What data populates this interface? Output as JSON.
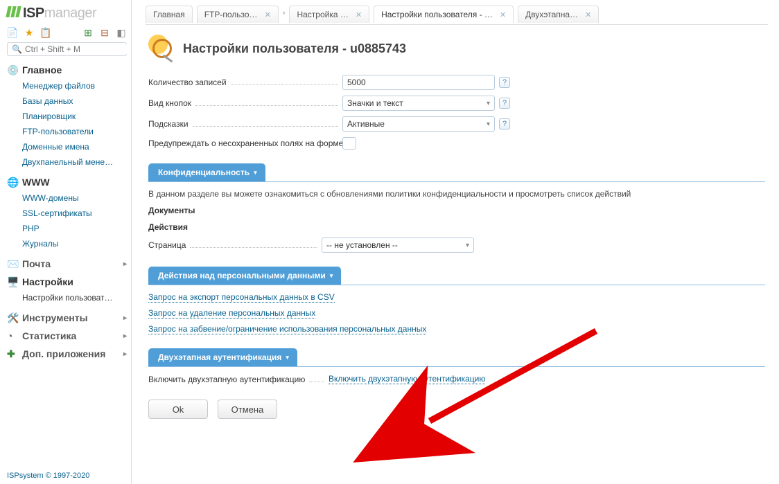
{
  "brand": {
    "isp": "ISP",
    "mgr": "manager"
  },
  "search_placeholder": "Ctrl + Shift + M",
  "sidebar": {
    "sections": [
      {
        "title": "Главное",
        "expanded": true,
        "icon": "disc-green",
        "items": [
          "Менеджер файлов",
          "Базы данных",
          "Планировщик",
          "FTP-пользователи",
          "Доменные имена",
          "Двухпанельный мене…"
        ]
      },
      {
        "title": "WWW",
        "expanded": true,
        "icon": "globe",
        "items": [
          "WWW-домены",
          "SSL-сертификаты",
          "PHP",
          "Журналы"
        ]
      },
      {
        "title": "Почта",
        "expanded": false,
        "icon": "mail",
        "items": []
      },
      {
        "title": "Настройки",
        "expanded": true,
        "icon": "monitor",
        "items": [
          "Настройки пользоват…"
        ]
      },
      {
        "title": "Инструменты",
        "expanded": false,
        "icon": "tools",
        "items": []
      },
      {
        "title": "Статистика",
        "expanded": false,
        "icon": "pie",
        "items": []
      },
      {
        "title": "Доп. приложения",
        "expanded": false,
        "icon": "plus",
        "items": []
      }
    ]
  },
  "footer": "ISPsystem © 1997-2020",
  "tabs": [
    {
      "label": "Главная",
      "closable": false,
      "active": false
    },
    {
      "label": "FTP-пользо…",
      "closable": true,
      "active": false,
      "crumb": true
    },
    {
      "label": "Настройка …",
      "closable": true,
      "active": false
    },
    {
      "label": "Настройки пользователя - …",
      "closable": true,
      "active": true
    },
    {
      "label": "Двухэтапна…",
      "closable": true,
      "active": false
    }
  ],
  "page_title": "Настройки пользователя - u0885743",
  "form": {
    "records_label": "Количество записей",
    "records_value": "5000",
    "buttons_view_label": "Вид кнопок",
    "buttons_view_value": "Значки и текст",
    "hints_label": "Подсказки",
    "hints_value": "Активные",
    "warn_label": "Предупреждать о несохраненных полях на форме"
  },
  "privacy": {
    "pill": "Конфиденциальность",
    "note": "В данном разделе вы можете ознакомиться с обновлениями политики конфиденциальности и просмотреть список действий",
    "docs": "Документы",
    "actions": "Действия",
    "page_label": "Страница",
    "page_value": "-- не установлен --"
  },
  "personal": {
    "pill": "Действия над персональными данными",
    "links": [
      "Запрос на экспорт персональных данных в CSV",
      "Запрос на удаление персональных данных",
      "Запрос на забвение/ограничение использования персональных данных"
    ]
  },
  "twofa": {
    "pill": "Двухэтапная аутентификация",
    "label": "Включить двухэтапную аутентификацию",
    "link": "Включить двухэтапную аутентификацию"
  },
  "buttons": {
    "ok": "Ok",
    "cancel": "Отмена"
  }
}
